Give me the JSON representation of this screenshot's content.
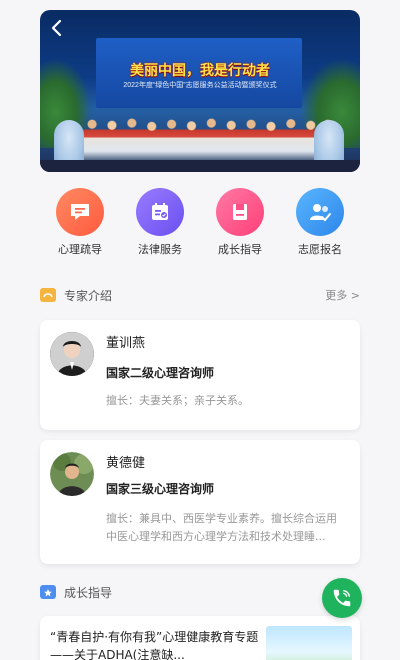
{
  "banner": {
    "title": "美丽中国，我是行动者",
    "subtitle": "2022年度“绿色中国”志愿服务公益活动暨颁奖仪式"
  },
  "menu": [
    {
      "label": "心理疏导",
      "icon": "chat-icon",
      "color": "#ff6b4f"
    },
    {
      "label": "法律服务",
      "icon": "calendar-icon",
      "color": "#7a5cf5"
    },
    {
      "label": "成长指导",
      "icon": "book-icon",
      "color": "#ff4f86"
    },
    {
      "label": "志愿报名",
      "icon": "people-icon",
      "color": "#3a9bf3"
    }
  ],
  "experts_section": {
    "title": "专家介绍",
    "more": "更多 >",
    "icon_color": "#f4b43e"
  },
  "experts": [
    {
      "name": "董训燕",
      "title": "国家二级心理咨询师",
      "skill": "擅长：夫妻关系；亲子关系。"
    },
    {
      "name": "黄德健",
      "title": "国家三级心理咨询师",
      "skill": "擅长：兼具中、西医学专业素养。擅长综合运用中医心理学和西方心理学方法和技术处理睡..."
    }
  ],
  "growth_section": {
    "title": "成长指导",
    "icon_color": "#4d8ef0"
  },
  "growth_article": {
    "title": "“青春自护·有你有我”心理健康教育专题——关于ADHA(注意缺..."
  },
  "call_button": {
    "icon": "phone-icon",
    "color": "#1fb35d"
  }
}
